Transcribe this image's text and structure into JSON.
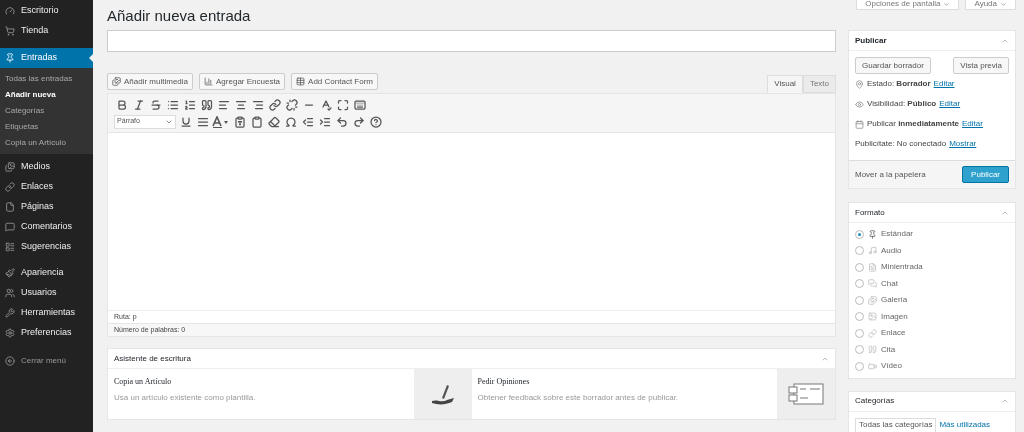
{
  "sidebar": {
    "groups": [
      {
        "items": [
          {
            "label": "Escritorio",
            "selected": false
          },
          {
            "label": "Tienda",
            "selected": false
          }
        ]
      },
      {
        "items": [
          {
            "label": "Entradas",
            "selected": true,
            "children": [
              {
                "label": "Todas las entradas",
                "selected": false
              },
              {
                "label": "Añadir nueva",
                "selected": true
              },
              {
                "label": "Categorías",
                "selected": false
              },
              {
                "label": "Etiquetas",
                "selected": false
              },
              {
                "label": "Copia un Artículo",
                "selected": false
              }
            ]
          },
          {
            "label": "Medios",
            "selected": false
          },
          {
            "label": "Enlaces",
            "selected": false
          },
          {
            "label": "Páginas",
            "selected": false
          },
          {
            "label": "Comentarios",
            "selected": false
          },
          {
            "label": "Sugerencias",
            "selected": false
          }
        ]
      },
      {
        "items": [
          {
            "label": "Apariencia",
            "selected": false
          },
          {
            "label": "Usuarios",
            "selected": false
          },
          {
            "label": "Herramientas",
            "selected": false
          },
          {
            "label": "Preferencias",
            "selected": false
          }
        ]
      }
    ],
    "collapse": "Cerrar menú"
  },
  "page_title": "Añadir nueva entrada",
  "media_buttons": [
    "Añadir multimedia",
    "Agregar Encuesta",
    "Add Contact Form"
  ],
  "editor_tabs": [
    {
      "label": "Visual",
      "selected": true
    },
    {
      "label": "Texto",
      "selected": false
    }
  ],
  "format_select": {
    "value": "Párrafo"
  },
  "path": "Ruta: p",
  "word_count": "Número de palabras: 0",
  "top_buttons": [
    "Opciones de pantalla",
    "Ayuda"
  ],
  "writing_assistant": {
    "title": "Asistente de escritura",
    "cards": [
      {
        "title": "Copia un Artículo",
        "text": "Usa un artículo existente como plantilla."
      },
      {
        "title": "Pedir Opiniones",
        "text": "Obtener feedback sobre este borrador antes de publicar."
      }
    ]
  },
  "publish": {
    "title": "Publicar",
    "save_draft": "Guardar borrador",
    "preview": "Vista previa",
    "rows": [
      {
        "text": "Estado: **Borrador**",
        "link": "Editar"
      },
      {
        "text": "Visibilidad: **Público**",
        "link": "Editar"
      },
      {
        "text": "Publicar **inmediatamente**",
        "link": "Editar"
      },
      {
        "text": "Publicítate: No conectado",
        "link": "Mostrar"
      }
    ],
    "trash": "Mover a la papelera",
    "publish_button": "Publicar"
  },
  "format": {
    "title": "Formato",
    "options": [
      {
        "label": "Estándar",
        "selected": true
      },
      {
        "label": "Audio",
        "selected": false
      },
      {
        "label": "Minientrada",
        "selected": false
      },
      {
        "label": "Chat",
        "selected": false
      },
      {
        "label": "Galería",
        "selected": false
      },
      {
        "label": "Imagen",
        "selected": false
      },
      {
        "label": "Enlace",
        "selected": false
      },
      {
        "label": "Cita",
        "selected": false
      },
      {
        "label": "Vídeo",
        "selected": false
      }
    ]
  },
  "categories": {
    "title": "Categorías",
    "tabs": [
      {
        "label": "Todas las categorías",
        "selected": true
      },
      {
        "label": "Más utilizadas",
        "selected": false
      }
    ]
  }
}
